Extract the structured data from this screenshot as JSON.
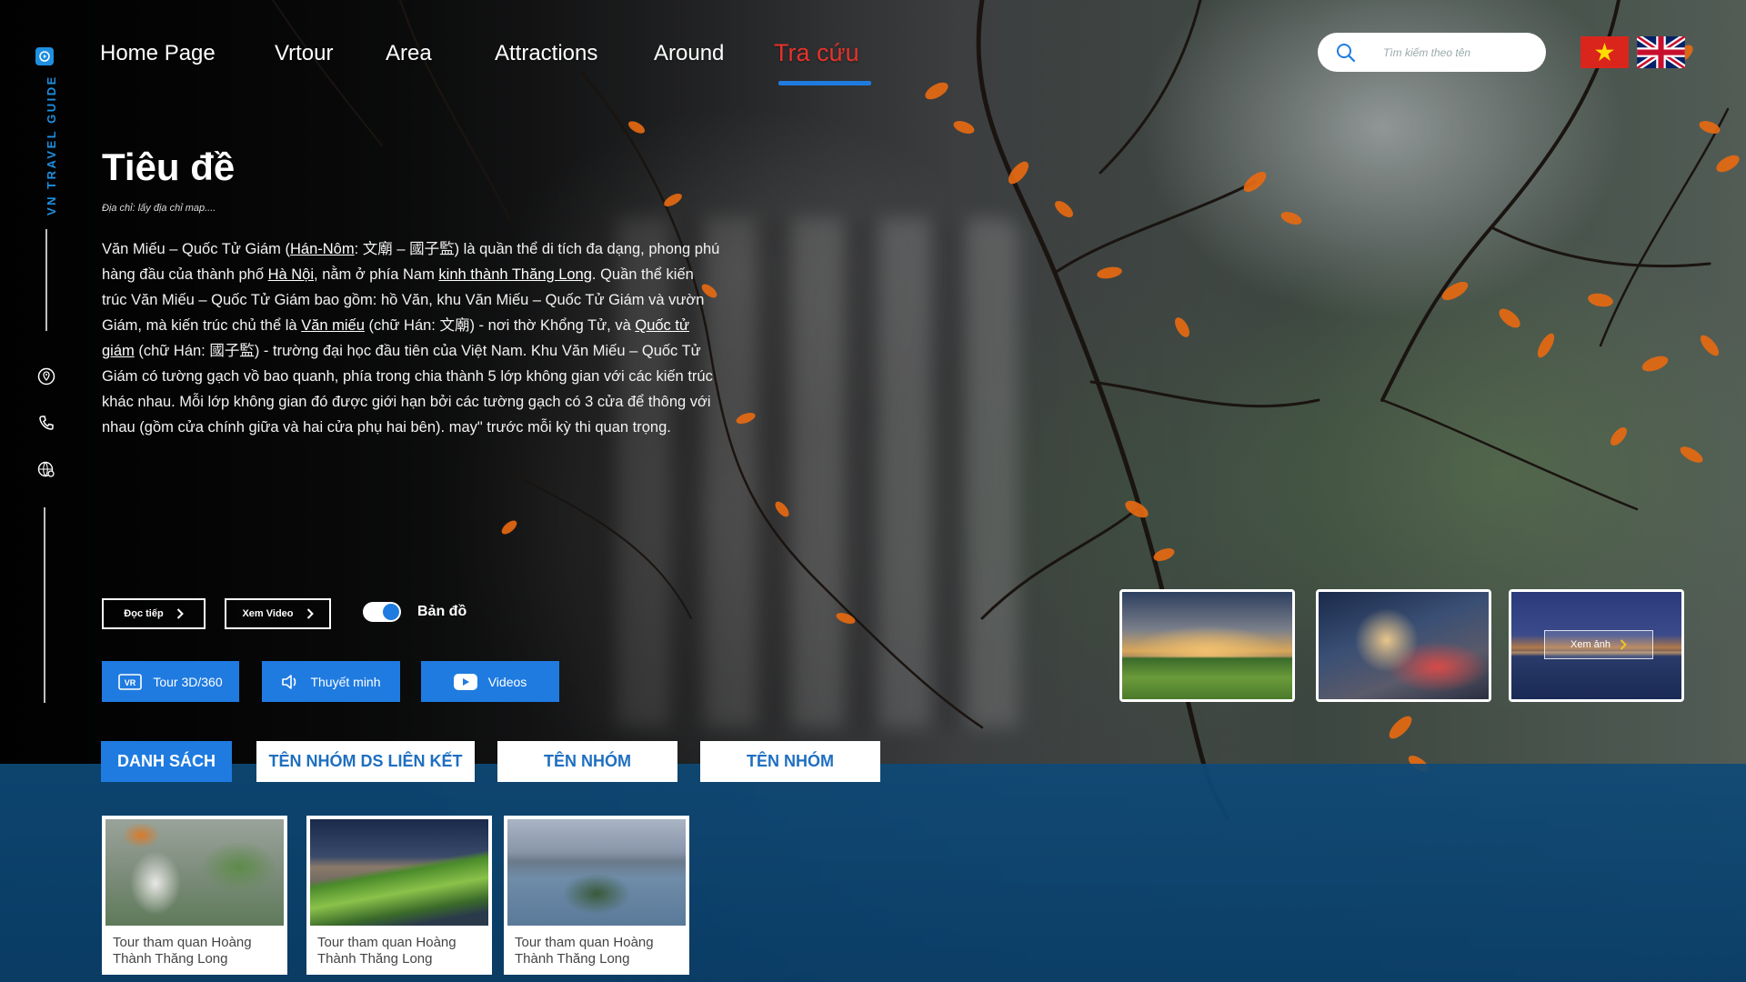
{
  "brand": {
    "name": "VN TRAVEL GUIDE"
  },
  "colors": {
    "accent": "#1f7be0",
    "active_nav": "#e8322b",
    "lake": "#0e4a78"
  },
  "nav": {
    "items": [
      {
        "label": "Home Page"
      },
      {
        "label": "Vrtour"
      },
      {
        "label": "Area"
      },
      {
        "label": "Attractions"
      },
      {
        "label": "Around"
      },
      {
        "label": "Tra cứu",
        "active": true
      }
    ]
  },
  "search": {
    "placeholder": "Tìm kiếm theo tên",
    "value": ""
  },
  "languages": [
    {
      "name": "Tiếng Việt",
      "icon": "flag-vietnam-icon"
    },
    {
      "name": "English",
      "icon": "flag-uk-icon"
    }
  ],
  "rail": {
    "icons": [
      "location-pin-icon",
      "phone-icon",
      "globe-pin-icon"
    ]
  },
  "content": {
    "title": "Tiêu đề",
    "address": "Địa chỉ: lấy địa chỉ map....",
    "desc": {
      "t1": "Văn Miếu – Quốc Tử Giám (",
      "l1": "Hán-Nôm",
      "t2": ": 文廟 – 國子監) là quần thể di tích đa dạng, phong phú hàng đầu của thành phố ",
      "l2": "Hà Nội",
      "t3": ", nằm ở phía Nam ",
      "l3": "kinh thành Thăng Long",
      "t4": ". Quần thể kiến trúc Văn Miếu – Quốc Tử Giám bao gồm: hồ Văn, khu Văn Miếu – Quốc Tử Giám và vườn Giám, mà kiến trúc chủ thể là ",
      "l4": "Văn miếu",
      "t5": " (chữ Hán: 文廟) - nơi thờ Khổng Tử, và ",
      "l5": "Quốc tử giám",
      "t6": " (chữ Hán: 國子監) - trường đại học đầu tiên của Việt Nam. Khu Văn Miếu – Quốc Tử Giám có tường gạch vồ bao quanh, phía trong chia thành 5 lớp không gian với các kiến trúc khác nhau. Mỗi lớp không gian đó được giới hạn bởi các tường gạch có 3 cửa để thông với nhau (gồm cửa chính giữa và hai cửa phụ hai bên). may\" trước mỗi kỳ thi quan trọng."
    }
  },
  "actions": {
    "read_more": "Đọc tiếp",
    "watch_video": "Xem Video",
    "map_toggle_label": "Bản đồ",
    "map_toggle_on": true,
    "tour_label": "Tour 3D/360",
    "narration_label": "Thuyết minh",
    "videos_label": "Videos"
  },
  "gallery": {
    "view_images_label": "Xem ảnh"
  },
  "tabs": [
    {
      "label": "DANH SÁCH",
      "active": true
    },
    {
      "label": "TÊN NHÓM DS LIÊN KẾT"
    },
    {
      "label": "TÊN NHÓM"
    },
    {
      "label": "TÊN NHÓM"
    }
  ],
  "cards": [
    {
      "title": "Tour tham quan Hoàng Thành Thăng Long"
    },
    {
      "title": "Tour tham quan Hoàng Thành Thăng Long"
    },
    {
      "title": "Tour tham quan Hoàng Thành Thăng Long"
    }
  ]
}
